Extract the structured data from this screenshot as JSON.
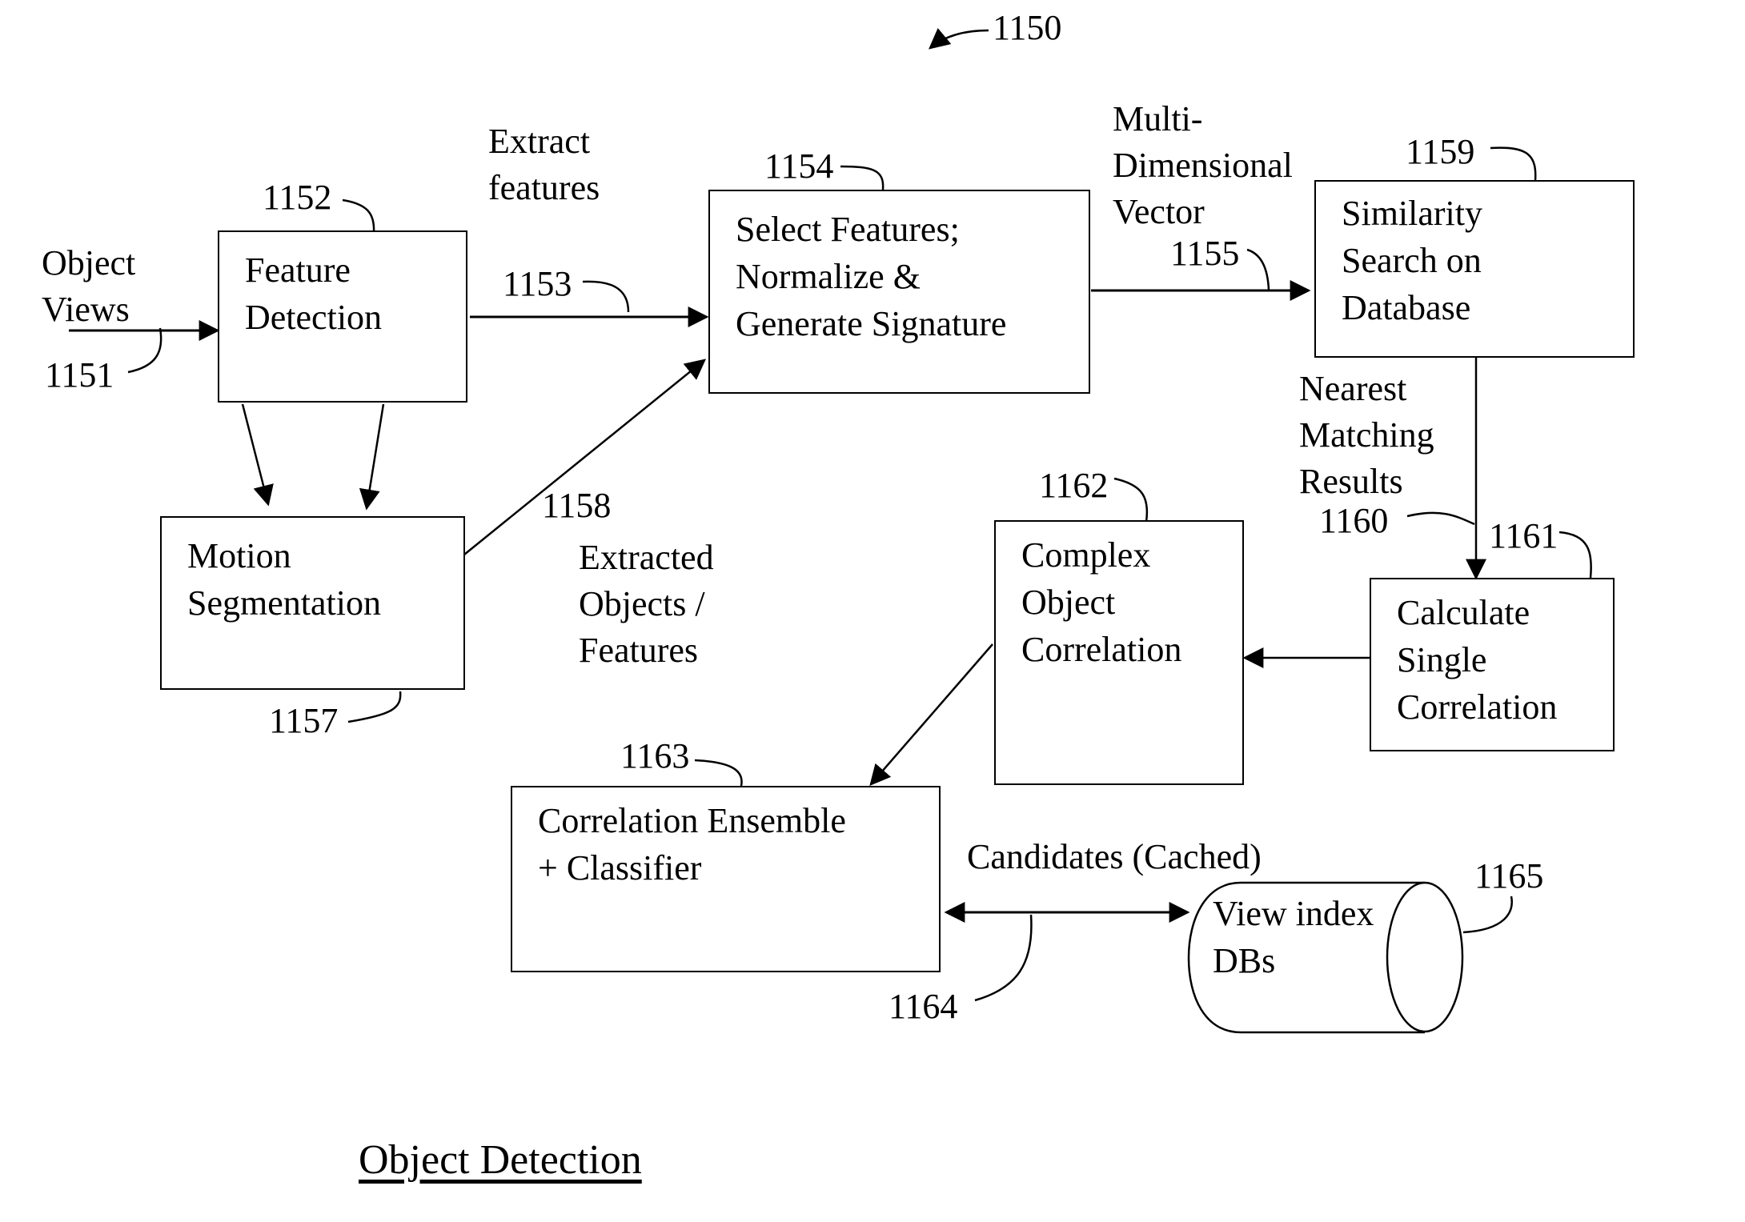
{
  "figure": {
    "reference": "1150",
    "caption": "Object Detection"
  },
  "nodes": {
    "feature_detection": {
      "ref": "1152",
      "label": "Feature\nDetection"
    },
    "motion_segmentation": {
      "ref": "1157",
      "label": "Motion\nSegmentation"
    },
    "select_features": {
      "ref": "1154",
      "label": "Select Features;\nNormalize &\nGenerate Signature"
    },
    "similarity_search": {
      "ref": "1159",
      "label": "Similarity\nSearch on\nDatabase"
    },
    "calculate_single": {
      "ref": "1161",
      "label": "Calculate\nSingle\nCorrelation"
    },
    "complex_object": {
      "ref": "1162",
      "label": "Complex\nObject\nCorrelation"
    },
    "correlation_ensemble": {
      "ref": "1163",
      "label": "Correlation Ensemble\n+ Classifier"
    },
    "view_index_db": {
      "ref": "1165",
      "label": "View index\nDBs"
    }
  },
  "edges": {
    "object_views": {
      "ref": "1151",
      "label": "Object\nViews"
    },
    "extract_features": {
      "ref": "1153",
      "label": "Extract\nfeatures"
    },
    "extracted_objects": {
      "ref": "1158",
      "label": "Extracted\nObjects /\nFeatures"
    },
    "multi_dim_vector": {
      "ref": "1155",
      "label": "Multi-\nDimensional\nVector"
    },
    "nearest_matching": {
      "ref": "1160",
      "label": "Nearest\nMatching\nResults"
    },
    "candidates": {
      "ref": "1164",
      "label": "Candidates (Cached)"
    }
  }
}
